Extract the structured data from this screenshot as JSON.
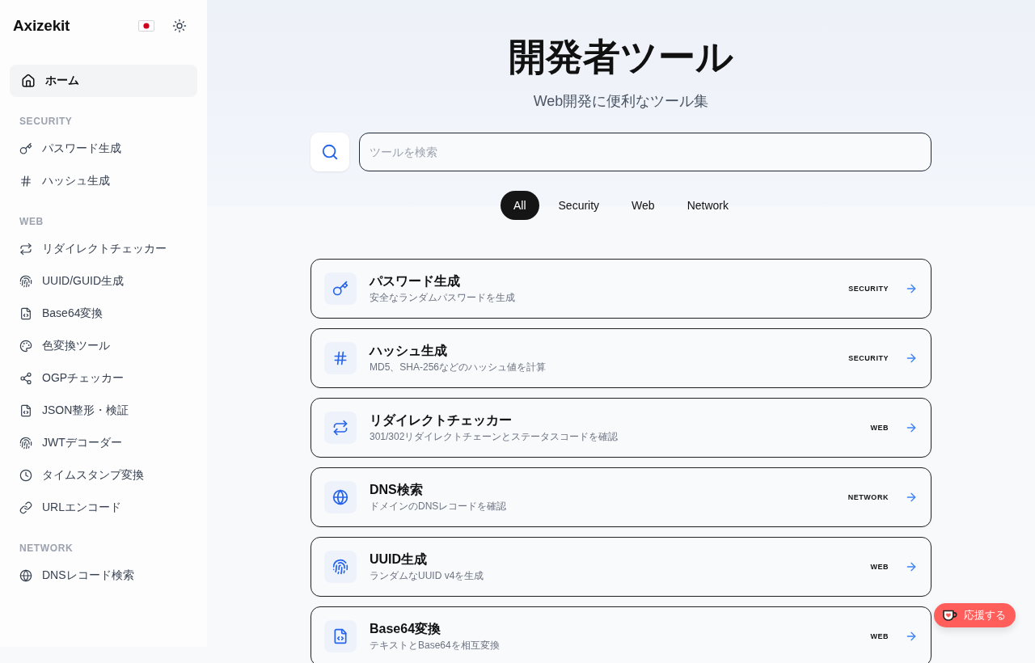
{
  "sidebar": {
    "logo": "Axizekit",
    "home": {
      "label": "ホーム",
      "selected": true
    },
    "sections": [
      {
        "heading": "SECURITY",
        "items": [
          {
            "label": "パスワード生成",
            "selected": false
          },
          {
            "label": "ハッシュ生成",
            "selected": false
          }
        ]
      },
      {
        "heading": "WEB",
        "items": [
          {
            "label": "リダイレクトチェッカー",
            "selected": false
          },
          {
            "label": "UUID/GUID生成",
            "selected": false
          },
          {
            "label": "Base64変換",
            "selected": false
          },
          {
            "label": "色変換ツール",
            "selected": false
          },
          {
            "label": "OGPチェッカー",
            "selected": false
          },
          {
            "label": "JSON整形・検証",
            "selected": false
          },
          {
            "label": "JWTデコーダー",
            "selected": false
          },
          {
            "label": "タイムスタンプ変換",
            "selected": false
          },
          {
            "label": "URLエンコード",
            "selected": false
          }
        ]
      },
      {
        "heading": "NETWORK",
        "items": [
          {
            "label": "DNSレコード検索",
            "selected": false
          }
        ]
      }
    ]
  },
  "header": {
    "title": "開発者ツール",
    "subtitle": "Web開発に便利なツール集"
  },
  "search": {
    "placeholder": "ツールを検索"
  },
  "filters": [
    {
      "label": "All",
      "selected": true
    },
    {
      "label": "Security",
      "selected": false
    },
    {
      "label": "Web",
      "selected": false
    },
    {
      "label": "Network",
      "selected": false
    }
  ],
  "tools": [
    {
      "title": "パスワード生成",
      "description": "安全なランダムパスワードを生成",
      "category": "SECURITY"
    },
    {
      "title": "ハッシュ生成",
      "description": "MD5、SHA-256などのハッシュ値を計算",
      "category": "SECURITY"
    },
    {
      "title": "リダイレクトチェッカー",
      "description": "301/302リダイレクトチェーンとステータスコードを確認",
      "category": "WEB"
    },
    {
      "title": "DNS検索",
      "description": "ドメインのDNSレコードを確認",
      "category": "NETWORK"
    },
    {
      "title": "UUID生成",
      "description": "ランダムなUUID v4を生成",
      "category": "WEB"
    },
    {
      "title": "Base64変換",
      "description": "テキストとBase64を相互変換",
      "category": "WEB"
    }
  ],
  "support_button": {
    "label": "応援する"
  }
}
